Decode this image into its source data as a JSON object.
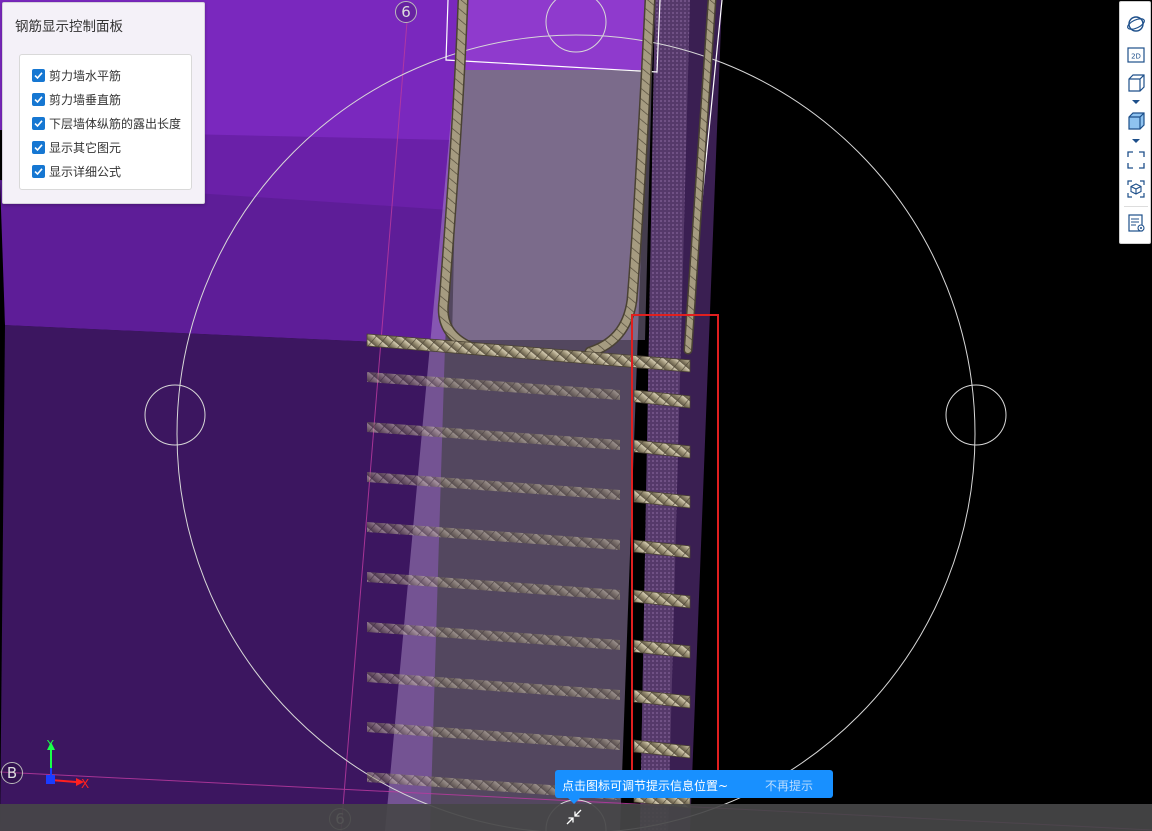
{
  "panel": {
    "title": "钢筋显示控制面板",
    "options": [
      {
        "label": "剪力墙水平筋",
        "checked": true
      },
      {
        "label": "剪力墙垂直筋",
        "checked": true
      },
      {
        "label": "下层墙体纵筋的露出长度",
        "checked": true
      },
      {
        "label": "显示其它图元",
        "checked": true
      },
      {
        "label": "显示详细公式",
        "checked": true
      }
    ]
  },
  "grid_labels": {
    "top": "6",
    "bottom": "6",
    "left": "B"
  },
  "axis_triad": {
    "x": "X",
    "y": "Y"
  },
  "tip": {
    "message": "点击图标可调节提示信息位置~",
    "dismiss": "不再提示"
  },
  "toolbar": {
    "icons": [
      "orbit-icon",
      "view-2d-icon",
      "view-3d-wireframe-icon",
      "view-3d-solid-icon",
      "fullscreen-icon",
      "section-box-icon",
      "properties-view-icon"
    ],
    "view_2d_label": "2D"
  },
  "colors": {
    "accent": "#1890ff",
    "checkbox": "#1677d2",
    "highlight_box": "#e01f1f",
    "wall_purple": "#6a1fa6",
    "rebar": "#9c9077"
  }
}
